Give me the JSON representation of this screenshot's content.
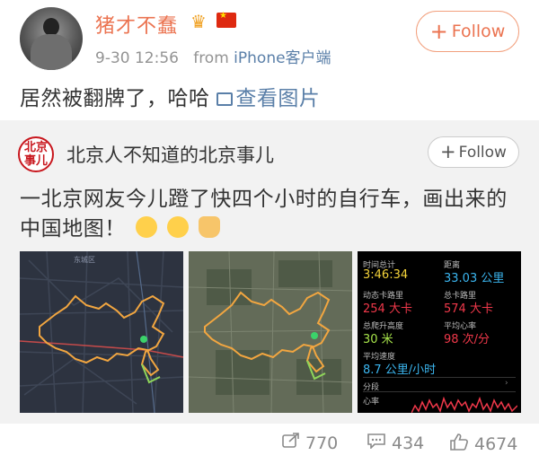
{
  "post": {
    "username": "猪才不蠢",
    "time": "9-30 12:56",
    "source_prefix": "from",
    "source": "iPhone客户端",
    "follow_label": "Follow",
    "text": "居然被翻牌了，哈哈",
    "view_images_label": "查看图片"
  },
  "repost": {
    "account": "北京人不知道的北京事儿",
    "avatar_text": "北京事儿",
    "follow_label": "Follow",
    "text": "一北京网友今儿蹬了快四个小时的自行车，画出来的中国地图！",
    "map_label": "东城区",
    "stats": {
      "time_label": "时间总计",
      "time_value": "3:46:34",
      "distance_label": "距离",
      "distance_value": "33.03 公里",
      "active_cal_label": "动态卡路里",
      "active_cal_value": "254 大卡",
      "total_cal_label": "总卡路里",
      "total_cal_value": "574 大卡",
      "elevation_label": "总爬升高度",
      "elevation_value": "30 米",
      "hr_label": "平均心率",
      "hr_value": "98 次/分",
      "speed_label": "平均速度",
      "speed_value": "8.7 公里/小时",
      "section_label": "分段",
      "heart_label": "心率"
    }
  },
  "actions": {
    "reposts": "770",
    "comments": "434",
    "likes": "4674"
  },
  "colors": {
    "username": "#eb7350",
    "link": "#5a7fa8",
    "route": "#f2a640",
    "stat_yellow": "#f4d33a",
    "stat_blue": "#3bb6f0",
    "stat_red": "#f0384a",
    "stat_green": "#a6e34a"
  }
}
